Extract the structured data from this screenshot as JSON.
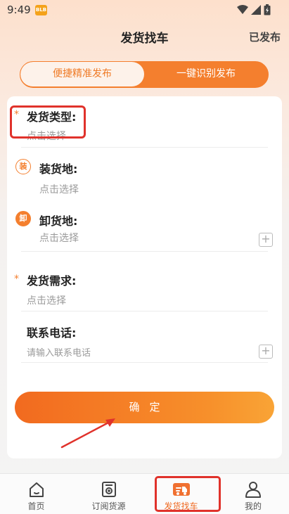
{
  "status_bar": {
    "time": "9:49",
    "app_badge": "BLB"
  },
  "header": {
    "title": "发货找车",
    "published": "已发布"
  },
  "tabs": [
    {
      "label": "便捷精准发布",
      "active": false
    },
    {
      "label": "一键识别发布",
      "active": true
    }
  ],
  "form": {
    "cargo_type": {
      "required_mark": "*",
      "label": "发货类型:",
      "placeholder": "点击选择"
    },
    "loading_place": {
      "badge": "装",
      "label": "装货地:",
      "placeholder": "点击选择"
    },
    "unloading_place": {
      "badge": "卸",
      "label": "卸货地:",
      "placeholder": "点击选择",
      "add": "+"
    },
    "requirement": {
      "required_mark": "*",
      "label": "发货需求:",
      "placeholder": "点击选择"
    },
    "phone": {
      "label": "联系电话:",
      "placeholder": "请输入联系电话",
      "add": "+"
    },
    "confirm_label": "确定"
  },
  "bottom_nav": [
    {
      "label": "首页",
      "icon": "home-icon",
      "active": false
    },
    {
      "label": "订阅货源",
      "icon": "subscribe-icon",
      "active": false
    },
    {
      "label": "发货找车",
      "icon": "truck-icon",
      "active": true
    },
    {
      "label": "我的",
      "icon": "person-icon",
      "active": false
    }
  ],
  "colors": {
    "accent": "#f47f2e",
    "annotation": "#e0322b"
  }
}
